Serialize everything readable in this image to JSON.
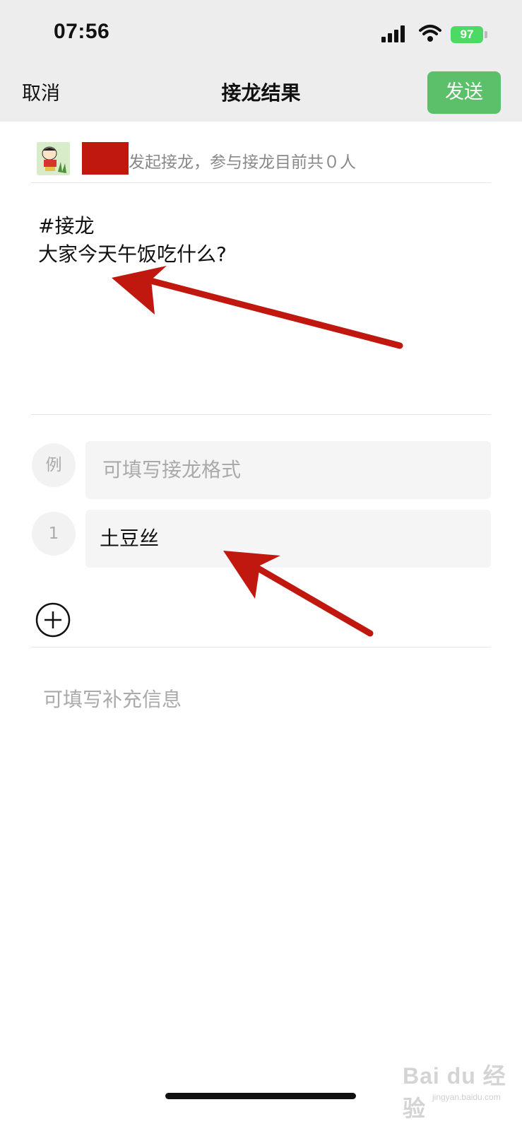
{
  "status_bar": {
    "time": "07:56",
    "battery": "97"
  },
  "nav": {
    "cancel": "取消",
    "title": "接龙结果",
    "send": "发送"
  },
  "creator": {
    "text": "发起接龙，参与接龙目前共０人"
  },
  "post": {
    "line1": "#接龙",
    "line2": "大家今天午饭吃什么?"
  },
  "example": {
    "badge": "例",
    "placeholder": "可填写接龙格式"
  },
  "entries": [
    {
      "badge": "1",
      "value": "土豆丝"
    }
  ],
  "supplement": {
    "placeholder": "可填写补充信息"
  },
  "watermark": {
    "text": "Bai du 经验",
    "sub": "jingyan.baidu.com"
  },
  "colors": {
    "send": "#5cc06b",
    "annotation_arrow": "#c0180f",
    "redaction": "#c0180f"
  }
}
